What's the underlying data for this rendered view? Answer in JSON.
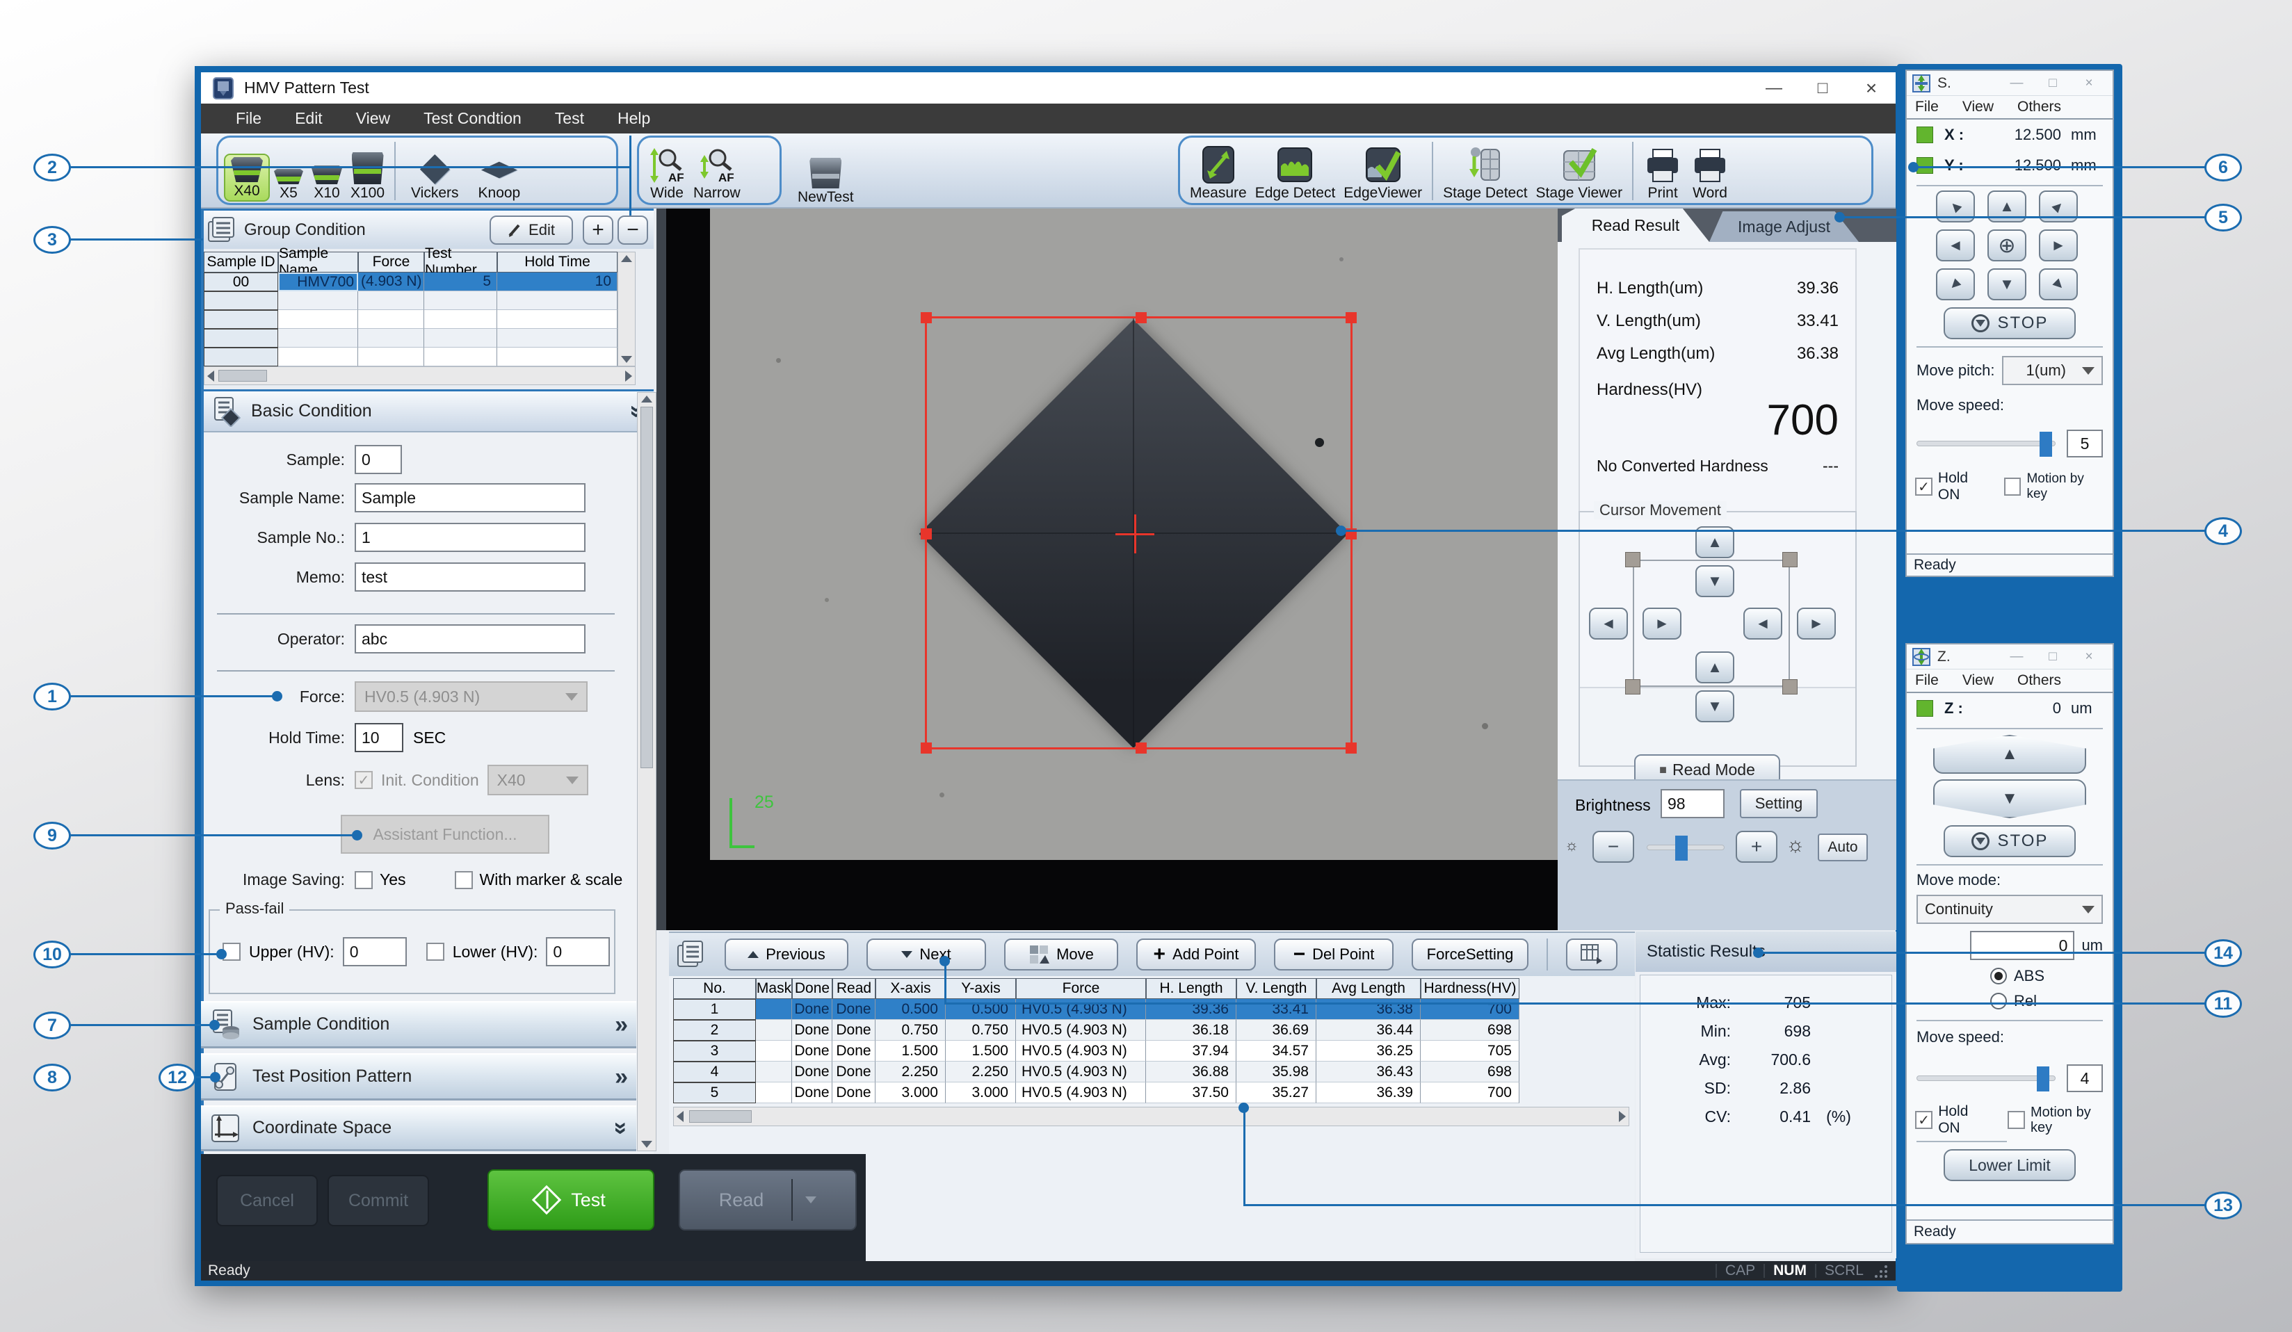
{
  "titlebar": {
    "title": "HMV Pattern Test"
  },
  "menubar": {
    "items": [
      "File",
      "Edit",
      "View",
      "Test Condtion",
      "Test",
      "Help"
    ]
  },
  "toolbar": {
    "x40": "X40",
    "x5": "X5",
    "x10": "X10",
    "x100": "X100",
    "vickers": "Vickers",
    "knoop": "Knoop",
    "wide": "Wide",
    "narrow": "Narrow",
    "af": "AF",
    "newtest": "NewTest",
    "measure": "Measure",
    "edge_detect": "Edge Detect",
    "edge_viewer": "EdgeViewer",
    "stage_detect": "Stage Detect",
    "stage_viewer": "Stage Viewer",
    "print": "Print",
    "word": "Word"
  },
  "group_condition": {
    "title": "Group Condition",
    "edit": "Edit",
    "add": "+",
    "remove": "−",
    "headers": [
      "Sample ID",
      "Sample Name",
      "Force",
      "Test Number",
      "Hold Time"
    ],
    "row": {
      "id": "00",
      "name": "HMV700",
      "force": "(4.903 N)",
      "test_number": "5",
      "hold_time": "10"
    }
  },
  "basic": {
    "title": "Basic Condition",
    "sample_label": "Sample:",
    "sample": "0",
    "sample_name_label": "Sample Name:",
    "sample_name": "Sample",
    "sample_no_label": "Sample No.:",
    "sample_no": "1",
    "memo_label": "Memo:",
    "memo": "test",
    "operator_label": "Operator:",
    "operator": "abc",
    "force_label": "Force:",
    "force": "HV0.5 (4.903 N)",
    "hold_time_label": "Hold Time:",
    "hold_time": "10",
    "sec": "SEC",
    "lens_label": "Lens:",
    "init_condition": "Init. Condition",
    "lens": "X40",
    "assistant": "Assistant Function...",
    "image_saving_label": "Image Saving:",
    "yes": "Yes",
    "marker": "With marker & scale",
    "passfail": "Pass-fail",
    "upper_label": "Upper (HV):",
    "upper": "0",
    "lower_label": "Lower (HV):",
    "lower": "0"
  },
  "sections": {
    "sample_condition": "Sample Condition",
    "test_position": "Test Position Pattern",
    "coordinate_space": "Coordinate Space"
  },
  "actions": {
    "cancel": "Cancel",
    "commit": "Commit",
    "test": "Test",
    "read": "Read"
  },
  "image_view": {
    "scale_label": "25"
  },
  "read_result": {
    "tab_read": "Read Result",
    "tab_adjust": "Image Adjust",
    "h_label": "H. Length(um)",
    "h": "39.36",
    "v_label": "V. Length(um)",
    "v": "33.41",
    "avg_label": "Avg Length(um)",
    "avg": "36.38",
    "hardness_label": "Hardness(HV)",
    "hardness": "700",
    "no_conv_label": "No Converted Hardness",
    "no_conv": "---",
    "cursor_movement": "Cursor Movement",
    "read_mode": "Read Mode",
    "brightness_label": "Brightness",
    "brightness": "98",
    "setting": "Setting",
    "auto": "Auto"
  },
  "points": {
    "previous": "Previous",
    "next": "Next",
    "move": "Move",
    "add_point": "Add Point",
    "del_point": "Del Point",
    "force_setting": "ForceSetting",
    "headers": [
      "No.",
      "Mask",
      "Done",
      "Read",
      "X-axis",
      "Y-axis",
      "Force",
      "H. Length",
      "V. Length",
      "Avg Length",
      "Hardness(HV)"
    ],
    "rows": [
      [
        "1",
        "",
        "Done",
        "Done",
        "0.500",
        "0.500",
        "HV0.5 (4.903 N)",
        "39.36",
        "33.41",
        "36.38",
        "700"
      ],
      [
        "2",
        "",
        "Done",
        "Done",
        "0.750",
        "0.750",
        "HV0.5 (4.903 N)",
        "36.18",
        "36.69",
        "36.44",
        "698"
      ],
      [
        "3",
        "",
        "Done",
        "Done",
        "1.500",
        "1.500",
        "HV0.5 (4.903 N)",
        "37.94",
        "34.57",
        "36.25",
        "705"
      ],
      [
        "4",
        "",
        "Done",
        "Done",
        "2.250",
        "2.250",
        "HV0.5 (4.903 N)",
        "36.88",
        "35.98",
        "36.43",
        "698"
      ],
      [
        "5",
        "",
        "Done",
        "Done",
        "3.000",
        "3.000",
        "HV0.5 (4.903 N)",
        "37.50",
        "35.27",
        "36.39",
        "700"
      ]
    ]
  },
  "stats": {
    "title": "Statistic Results",
    "max_label": "Max:",
    "max": "705",
    "min_label": "Min:",
    "min": "698",
    "avg_label": "Avg:",
    "avg": "700.6",
    "sd_label": "SD:",
    "sd": "2.86",
    "cv_label": "CV:",
    "cv": "0.41",
    "cv_unit": "(%)"
  },
  "stage_xy": {
    "title": "S.",
    "menu": [
      "File",
      "View",
      "Others"
    ],
    "x_label": "X :",
    "x": "12.500",
    "x_unit": "mm",
    "y_label": "Y :",
    "y": "12.500",
    "y_unit": "mm",
    "stop": "STOP",
    "move_pitch_label": "Move pitch:",
    "move_pitch": "1(um)",
    "move_speed_label": "Move speed:",
    "move_speed": "5",
    "hold_on": "Hold ON",
    "motion_by_key": "Motion by key",
    "status": "Ready"
  },
  "stage_z": {
    "title": "Z.",
    "menu": [
      "File",
      "View",
      "Others"
    ],
    "z_label": "Z :",
    "z": "0",
    "z_unit": "um",
    "stop": "STOP",
    "move_mode_label": "Move mode:",
    "move_mode": "Continuity",
    "target": "0",
    "target_unit": "um",
    "abs": "ABS",
    "rel": "Rel",
    "move_speed_label": "Move speed:",
    "move_speed": "4",
    "hold_on": "Hold ON",
    "motion_by_key": "Motion by key",
    "lower_limit": "Lower Limit",
    "status": "Ready"
  },
  "statusbar": {
    "ready": "Ready",
    "cap": "CAP",
    "num": "NUM",
    "scrl": "SCRL"
  },
  "callouts": {
    "c1": "1",
    "c2": "2",
    "c3": "3",
    "c4": "4",
    "c5": "5",
    "c6": "6",
    "c7": "7",
    "c8": "8",
    "c9": "9",
    "c10": "10",
    "c11": "11",
    "c12": "12",
    "c13": "13",
    "c14": "14"
  },
  "icons": {
    "check": "✓",
    "chev_right2": "»",
    "up": "▲",
    "down": "▼",
    "left": "◄",
    "right": "►",
    "target": "⊕",
    "min": "—",
    "max": "□",
    "close": "×",
    "sun": "☼",
    "square": "■",
    "diamond": "◆"
  },
  "colors": {
    "accent_blue": "#1b6cb0",
    "selection_blue": "#2f80c8",
    "green": "#62b52e",
    "red": "#e8352b",
    "menu_dark": "#3b3b3b"
  }
}
